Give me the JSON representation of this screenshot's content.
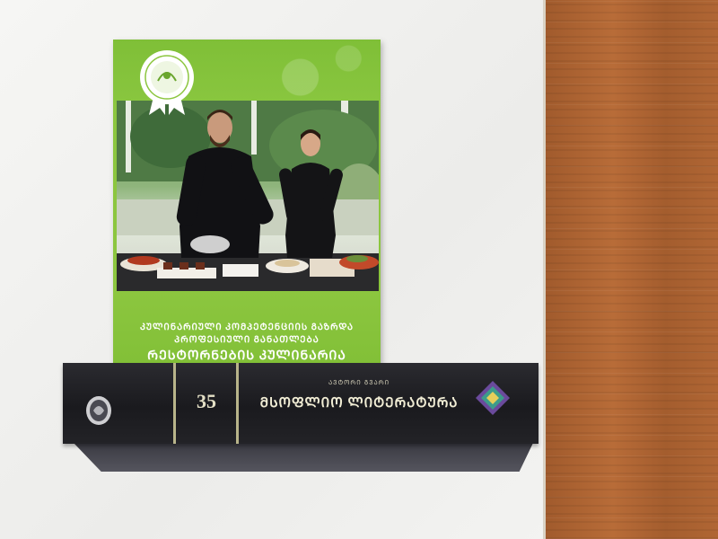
{
  "booklet": {
    "subtitle_line1": "ᲙᲣᲚᲘᲜᲐᲠᲘᲣᲚᲘ ᲙᲝᲛᲞᲔᲢᲔᲜᲪᲘᲘᲡ ᲒᲐᲖᲠᲓᲐ",
    "subtitle_line2": "ᲞᲠᲝᲤᲔᲡᲘᲣᲚᲘ ᲒᲐᲜᲐᲗᲚᲔᲑᲐ",
    "title": "ᲠᲔᲡᲢᲝᲠᲜᲔᲑᲘᲡ ᲙᲣᲚᲘᲜᲐᲠᲘᲐ"
  },
  "book": {
    "volume_number": "35",
    "author": "ᲐᲕᲢᲝᲠᲘ ᲒᲕᲐᲠᲘ",
    "title": "ᲛᲡᲝᲤᲚᲘᲝ ᲚᲘᲢᲔᲠᲐᲢᲣᲠᲐ"
  },
  "icons": {
    "booklet_seal": "ribbon-seal-icon",
    "spine_emblem": "oval-emblem-icon",
    "spine_ornament": "diamond-ornament-icon"
  },
  "colors": {
    "booklet_green": "#8cc63f",
    "spine_black": "#1f1f24",
    "wood": "#b06634"
  }
}
